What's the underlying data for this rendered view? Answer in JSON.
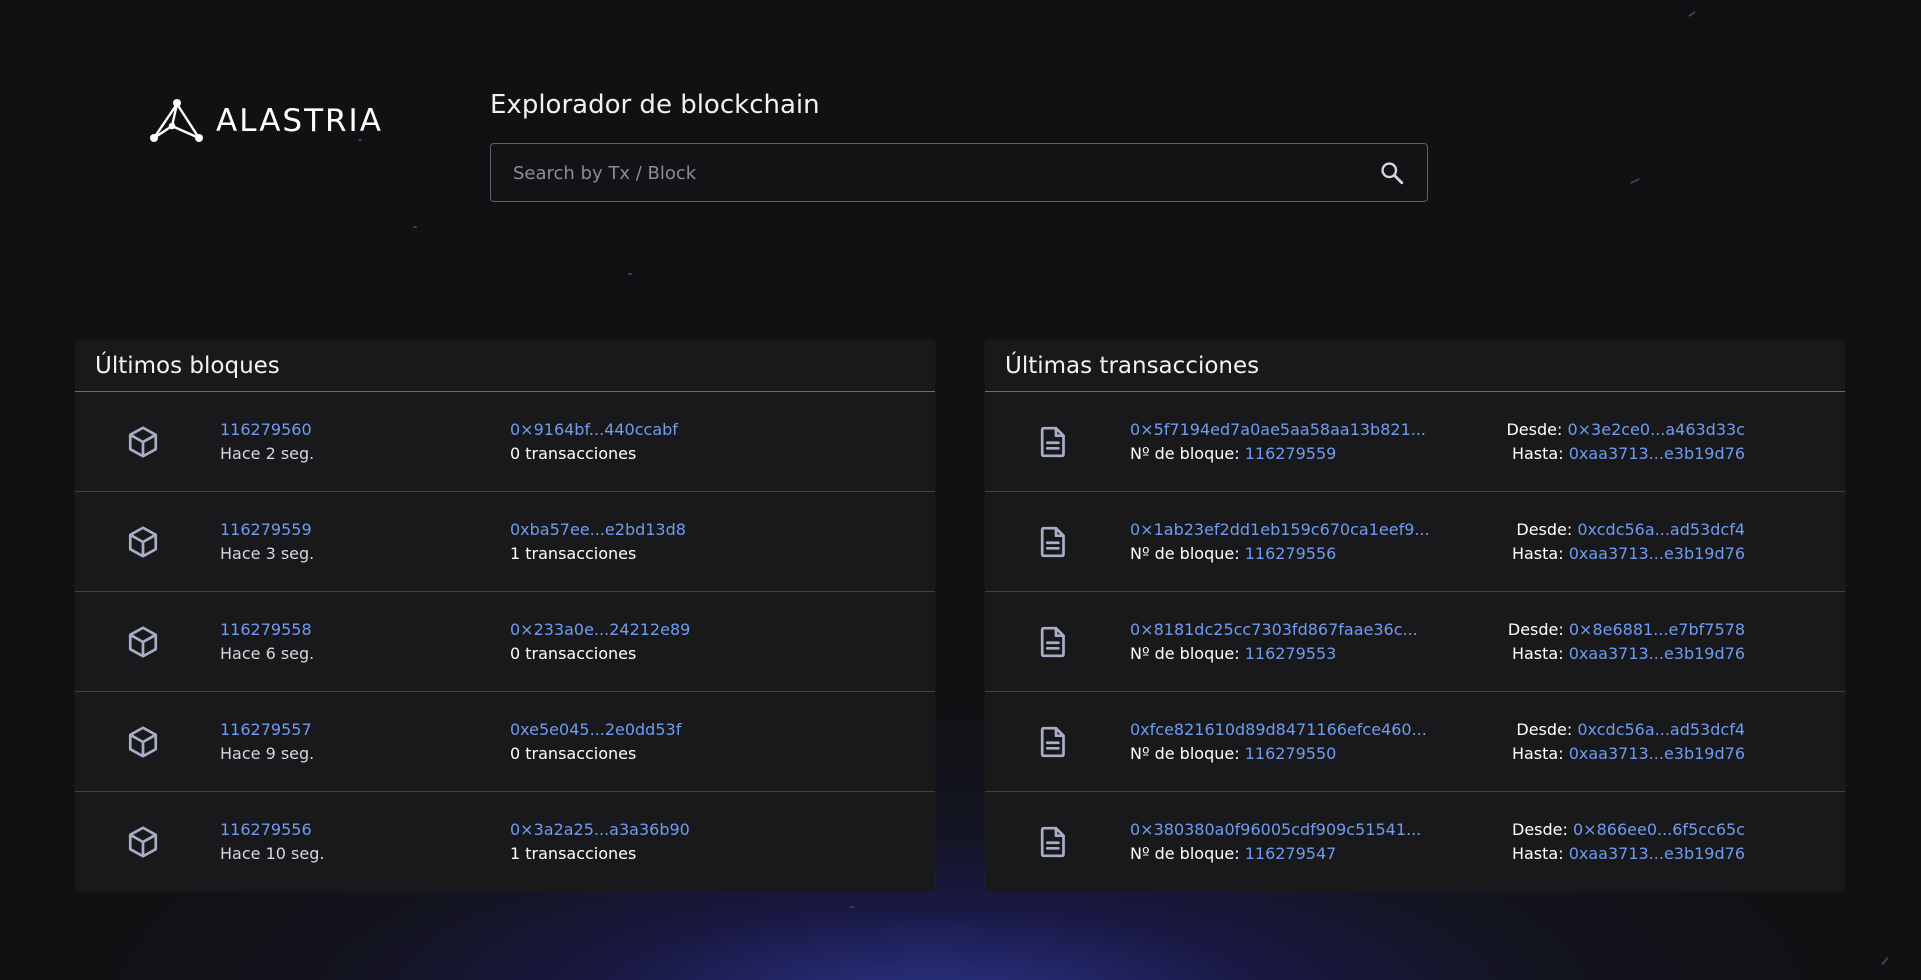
{
  "header": {
    "logo_text": "ALASTRIA",
    "title": "Explorador de blockchain"
  },
  "search": {
    "placeholder": "Search by Tx / Block",
    "value": ""
  },
  "blocks_panel": {
    "title": "Últimos bloques",
    "rows": [
      {
        "number": "116279560",
        "age": "Hace 2 seg.",
        "hash": "0×9164bf...440ccabf",
        "tx_count": "0 transacciones"
      },
      {
        "number": "116279559",
        "age": "Hace 3 seg.",
        "hash": "0xba57ee...e2bd13d8",
        "tx_count": "1 transacciones"
      },
      {
        "number": "116279558",
        "age": "Hace 6 seg.",
        "hash": "0×233a0e...24212e89",
        "tx_count": "0 transacciones"
      },
      {
        "number": "116279557",
        "age": "Hace 9 seg.",
        "hash": "0xe5e045...2e0dd53f",
        "tx_count": "0 transacciones"
      },
      {
        "number": "116279556",
        "age": "Hace 10 seg.",
        "hash": "0×3a2a25...a3a36b90",
        "tx_count": "1 transacciones"
      }
    ]
  },
  "tx_panel": {
    "title": "Últimas transacciones",
    "block_label": "Nº de bloque:",
    "from_label": "Desde:",
    "to_label": "Hasta:",
    "rows": [
      {
        "hash": "0×5f7194ed7a0ae5aa58aa13b821...",
        "block": "116279559",
        "from": "0×3e2ce0...a463d33c",
        "to": "0xaa3713...e3b19d76"
      },
      {
        "hash": "0×1ab23ef2dd1eb159c670ca1eef9...",
        "block": "116279556",
        "from": "0xcdc56a...ad53dcf4",
        "to": "0xaa3713...e3b19d76"
      },
      {
        "hash": "0×8181dc25cc7303fd867faae36c...",
        "block": "116279553",
        "from": "0×8e6881...e7bf7578",
        "to": "0xaa3713...e3b19d76"
      },
      {
        "hash": "0xfce821610d89d8471166efce460...",
        "block": "116279550",
        "from": "0xcdc56a...ad53dcf4",
        "to": "0xaa3713...e3b19d76"
      },
      {
        "hash": "0×380380a0f96005cdf909c51541...",
        "block": "116279547",
        "from": "0×866ee0...6f5cc65c",
        "to": "0xaa3713...e3b19d76"
      }
    ]
  },
  "colors": {
    "background": "#111113",
    "panel": "#19191c",
    "link": "#6f9cf0",
    "header_divider": "#5f66b4",
    "row_divider": "#3e3f49"
  },
  "icons": {
    "logo": "alastria-network-logo-icon",
    "search": "search-icon",
    "block": "cube-icon",
    "transaction": "document-icon"
  }
}
